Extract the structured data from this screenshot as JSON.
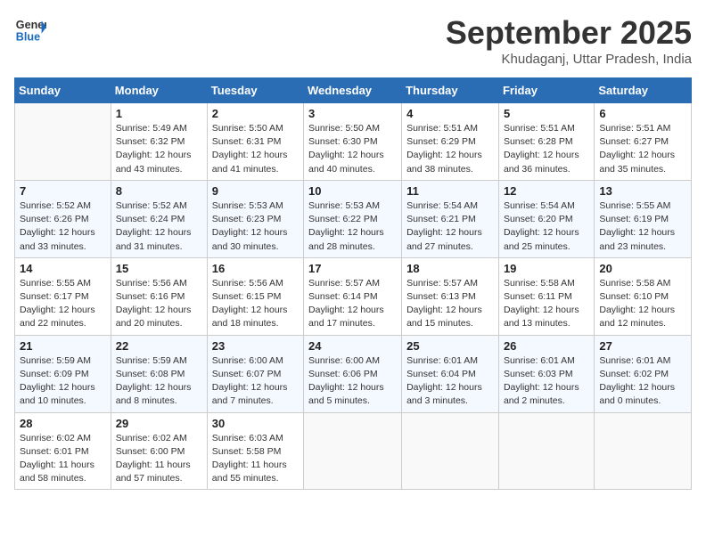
{
  "header": {
    "logo": {
      "line1": "General",
      "line2": "Blue"
    },
    "month": "September 2025",
    "location": "Khudaganj, Uttar Pradesh, India"
  },
  "weekdays": [
    "Sunday",
    "Monday",
    "Tuesday",
    "Wednesday",
    "Thursday",
    "Friday",
    "Saturday"
  ],
  "weeks": [
    [
      {
        "day": "",
        "info": ""
      },
      {
        "day": "1",
        "info": "Sunrise: 5:49 AM\nSunset: 6:32 PM\nDaylight: 12 hours\nand 43 minutes."
      },
      {
        "day": "2",
        "info": "Sunrise: 5:50 AM\nSunset: 6:31 PM\nDaylight: 12 hours\nand 41 minutes."
      },
      {
        "day": "3",
        "info": "Sunrise: 5:50 AM\nSunset: 6:30 PM\nDaylight: 12 hours\nand 40 minutes."
      },
      {
        "day": "4",
        "info": "Sunrise: 5:51 AM\nSunset: 6:29 PM\nDaylight: 12 hours\nand 38 minutes."
      },
      {
        "day": "5",
        "info": "Sunrise: 5:51 AM\nSunset: 6:28 PM\nDaylight: 12 hours\nand 36 minutes."
      },
      {
        "day": "6",
        "info": "Sunrise: 5:51 AM\nSunset: 6:27 PM\nDaylight: 12 hours\nand 35 minutes."
      }
    ],
    [
      {
        "day": "7",
        "info": "Sunrise: 5:52 AM\nSunset: 6:26 PM\nDaylight: 12 hours\nand 33 minutes."
      },
      {
        "day": "8",
        "info": "Sunrise: 5:52 AM\nSunset: 6:24 PM\nDaylight: 12 hours\nand 31 minutes."
      },
      {
        "day": "9",
        "info": "Sunrise: 5:53 AM\nSunset: 6:23 PM\nDaylight: 12 hours\nand 30 minutes."
      },
      {
        "day": "10",
        "info": "Sunrise: 5:53 AM\nSunset: 6:22 PM\nDaylight: 12 hours\nand 28 minutes."
      },
      {
        "day": "11",
        "info": "Sunrise: 5:54 AM\nSunset: 6:21 PM\nDaylight: 12 hours\nand 27 minutes."
      },
      {
        "day": "12",
        "info": "Sunrise: 5:54 AM\nSunset: 6:20 PM\nDaylight: 12 hours\nand 25 minutes."
      },
      {
        "day": "13",
        "info": "Sunrise: 5:55 AM\nSunset: 6:19 PM\nDaylight: 12 hours\nand 23 minutes."
      }
    ],
    [
      {
        "day": "14",
        "info": "Sunrise: 5:55 AM\nSunset: 6:17 PM\nDaylight: 12 hours\nand 22 minutes."
      },
      {
        "day": "15",
        "info": "Sunrise: 5:56 AM\nSunset: 6:16 PM\nDaylight: 12 hours\nand 20 minutes."
      },
      {
        "day": "16",
        "info": "Sunrise: 5:56 AM\nSunset: 6:15 PM\nDaylight: 12 hours\nand 18 minutes."
      },
      {
        "day": "17",
        "info": "Sunrise: 5:57 AM\nSunset: 6:14 PM\nDaylight: 12 hours\nand 17 minutes."
      },
      {
        "day": "18",
        "info": "Sunrise: 5:57 AM\nSunset: 6:13 PM\nDaylight: 12 hours\nand 15 minutes."
      },
      {
        "day": "19",
        "info": "Sunrise: 5:58 AM\nSunset: 6:11 PM\nDaylight: 12 hours\nand 13 minutes."
      },
      {
        "day": "20",
        "info": "Sunrise: 5:58 AM\nSunset: 6:10 PM\nDaylight: 12 hours\nand 12 minutes."
      }
    ],
    [
      {
        "day": "21",
        "info": "Sunrise: 5:59 AM\nSunset: 6:09 PM\nDaylight: 12 hours\nand 10 minutes."
      },
      {
        "day": "22",
        "info": "Sunrise: 5:59 AM\nSunset: 6:08 PM\nDaylight: 12 hours\nand 8 minutes."
      },
      {
        "day": "23",
        "info": "Sunrise: 6:00 AM\nSunset: 6:07 PM\nDaylight: 12 hours\nand 7 minutes."
      },
      {
        "day": "24",
        "info": "Sunrise: 6:00 AM\nSunset: 6:06 PM\nDaylight: 12 hours\nand 5 minutes."
      },
      {
        "day": "25",
        "info": "Sunrise: 6:01 AM\nSunset: 6:04 PM\nDaylight: 12 hours\nand 3 minutes."
      },
      {
        "day": "26",
        "info": "Sunrise: 6:01 AM\nSunset: 6:03 PM\nDaylight: 12 hours\nand 2 minutes."
      },
      {
        "day": "27",
        "info": "Sunrise: 6:01 AM\nSunset: 6:02 PM\nDaylight: 12 hours\nand 0 minutes."
      }
    ],
    [
      {
        "day": "28",
        "info": "Sunrise: 6:02 AM\nSunset: 6:01 PM\nDaylight: 11 hours\nand 58 minutes."
      },
      {
        "day": "29",
        "info": "Sunrise: 6:02 AM\nSunset: 6:00 PM\nDaylight: 11 hours\nand 57 minutes."
      },
      {
        "day": "30",
        "info": "Sunrise: 6:03 AM\nSunset: 5:58 PM\nDaylight: 11 hours\nand 55 minutes."
      },
      {
        "day": "",
        "info": ""
      },
      {
        "day": "",
        "info": ""
      },
      {
        "day": "",
        "info": ""
      },
      {
        "day": "",
        "info": ""
      }
    ]
  ]
}
